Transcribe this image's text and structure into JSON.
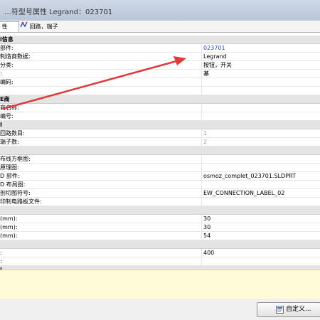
{
  "window": {
    "title": "…符型号属性 Legrand：023701"
  },
  "tabs": [
    {
      "label": "性",
      "icon": "properties-icon"
    },
    {
      "label": "回路，端子",
      "icon": "circuit-icon"
    }
  ],
  "rows": [
    {
      "type": "section",
      "label": "i信息"
    },
    {
      "type": "field",
      "label": "部件:",
      "value": "023701",
      "value_color": "blue"
    },
    {
      "type": "field",
      "label": "制造商数据:",
      "value": "Legrand"
    },
    {
      "type": "field",
      "label": "分类:",
      "value": "按钮，开关"
    },
    {
      "type": "field",
      "label": ":",
      "value": "基"
    },
    {
      "type": "field",
      "label": "编码:",
      "value": ""
    },
    {
      "type": "field",
      "label": "",
      "value": ""
    },
    {
      "type": "section",
      "label": "E商"
    },
    {
      "type": "field",
      "label": "商名称:",
      "value": ""
    },
    {
      "type": "field",
      "label": "编号:",
      "value": ""
    },
    {
      "type": "section",
      "label": "I"
    },
    {
      "type": "field",
      "label": "回路数目:",
      "value": "1",
      "value_color": "grey"
    },
    {
      "type": "field",
      "label": "端子数:",
      "value": "2",
      "value_color": "grey"
    },
    {
      "type": "section",
      "label": ""
    },
    {
      "type": "field",
      "label": "布线方框图:",
      "value": ""
    },
    {
      "type": "field",
      "label": "原理图:",
      "value": ""
    },
    {
      "type": "field",
      "label": "D 部件:",
      "value": "osmoz_complet_023701.SLDPRT"
    },
    {
      "type": "field",
      "label": "D 布局图:",
      "value": ""
    },
    {
      "type": "field",
      "label": "剖切图符号:",
      "value": "EW_CONNECTION_LABEL_02"
    },
    {
      "type": "field",
      "label": "印制电路板文件:",
      "value": ""
    },
    {
      "type": "section",
      "label": ""
    },
    {
      "type": "field",
      "label": " (mm):",
      "value": "30"
    },
    {
      "type": "field",
      "label": " (mm):",
      "value": "30"
    },
    {
      "type": "field",
      "label": " (mm):",
      "value": "54"
    },
    {
      "type": "section",
      "label": ""
    },
    {
      "type": "field",
      "label": ":",
      "value": "400"
    },
    {
      "type": "field",
      "label": ":",
      "value": ""
    },
    {
      "type": "section",
      "label": "I"
    }
  ],
  "notes": {
    "text": ""
  },
  "footer": {
    "customize_label": "自定义...",
    "customize_icon": "customize-icon"
  },
  "colors": {
    "value_blue": "#2a4fb5",
    "arrow_red": "#e03a3a",
    "notes_bg": "#fffbd9"
  }
}
